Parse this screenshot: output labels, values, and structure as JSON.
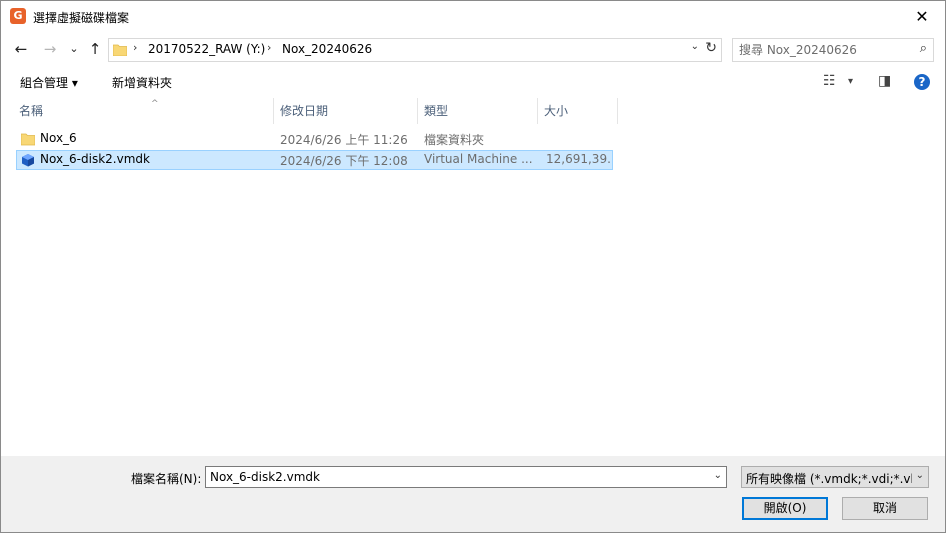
{
  "window": {
    "title": "選擇虛擬磁碟檔案",
    "app_icon_letter": "G",
    "close_glyph": "✕"
  },
  "nav": {
    "back": "←",
    "forward": "→",
    "recent": "⌄",
    "up": "↑"
  },
  "address": {
    "crumbs": [
      "20170522_RAW (Y:)",
      "Nox_20240626"
    ],
    "separator": "›"
  },
  "search": {
    "placeholder": "搜尋 Nox_20240626"
  },
  "toolbar": {
    "organize": "組合管理 ▾",
    "new_folder": "新增資料夾"
  },
  "columns": {
    "name": "名稱",
    "date": "修改日期",
    "type": "類型",
    "size": "大小"
  },
  "files": [
    {
      "name": "Nox_6",
      "date": "2024/6/26 上午 11:26",
      "type": "檔案資料夾",
      "size": "",
      "icon": "folder-icon"
    },
    {
      "name": "Nox_6-disk2.vmdk",
      "date": "2024/6/26 下午 12:08",
      "type": "Virtual Machine ...",
      "size": "12,691,39...",
      "icon": "virtual-disk-icon"
    }
  ],
  "footer": {
    "filename_label": "檔案名稱(N):",
    "filename_value": "Nox_6-disk2.vmdk",
    "filetype_value": "所有映像檔 (*.vmdk;*.vdi;*.vhd",
    "open_label": "開啟(O)",
    "cancel_label": "取消"
  },
  "colors": {
    "accent": "#0078d7",
    "selection": "#cce8ff",
    "folder": "#f8d775"
  }
}
